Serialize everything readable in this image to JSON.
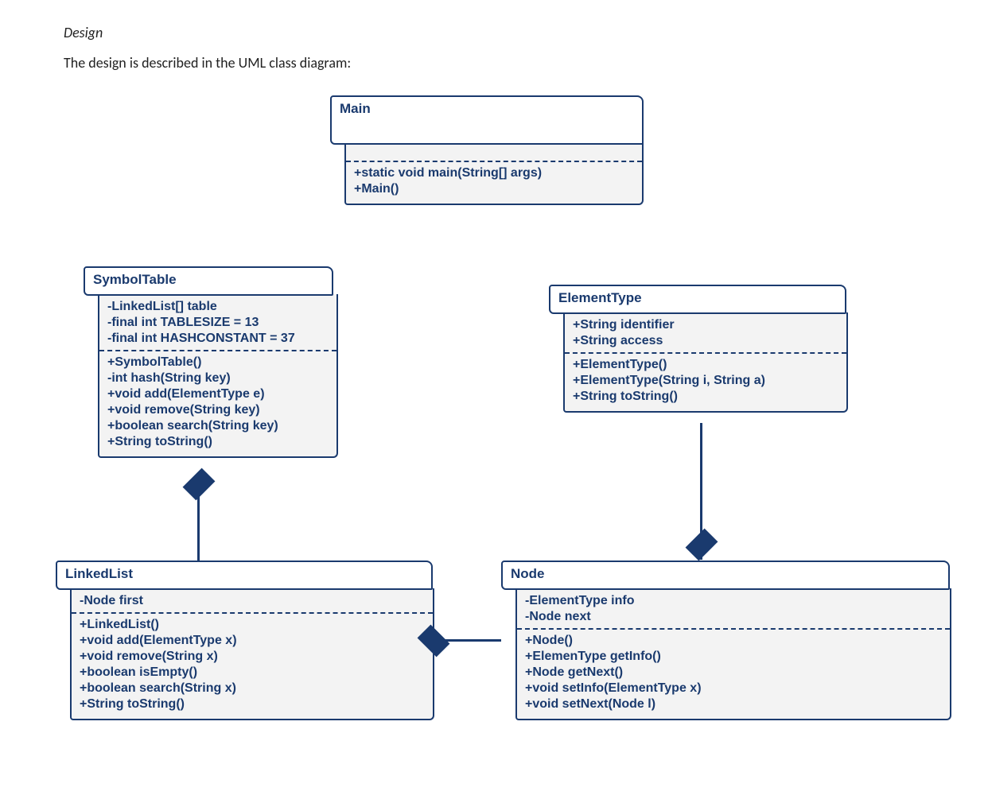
{
  "heading": {
    "title": "Design",
    "description": "The design is described in the UML class diagram:"
  },
  "classes": {
    "Main": {
      "name": "Main",
      "attributes": [],
      "methods": [
        "+static void main(String[] args)",
        "+Main()"
      ]
    },
    "SymbolTable": {
      "name": "SymbolTable",
      "attributes": [
        "-LinkedList[] table",
        "-final int TABLESIZE = 13",
        "-final int HASHCONSTANT = 37"
      ],
      "methods": [
        "+SymbolTable()",
        "-int hash(String key)",
        "+void add(ElementType e)",
        "+void remove(String key)",
        "+boolean search(String key)",
        "+String toString()"
      ]
    },
    "ElementType": {
      "name": "ElementType",
      "attributes": [
        "+String identifier",
        "+String access"
      ],
      "methods": [
        "+ElementType()",
        "+ElementType(String i, String a)",
        "+String toString()"
      ]
    },
    "LinkedList": {
      "name": "LinkedList",
      "attributes": [
        "-Node first"
      ],
      "methods": [
        "+LinkedList()",
        "+void add(ElementType x)",
        "+void remove(String x)",
        "+boolean isEmpty()",
        "+boolean search(String x)",
        "+String toString()"
      ]
    },
    "Node": {
      "name": "Node",
      "attributes": [
        "-ElementType info",
        "-Node next"
      ],
      "methods": [
        "+Node()",
        "+ElemenType getInfo()",
        "+Node getNext()",
        "+void setInfo(ElementType x)",
        "+void setNext(Node l)"
      ]
    }
  },
  "relationships": [
    {
      "type": "composition",
      "whole": "SymbolTable",
      "part": "LinkedList"
    },
    {
      "type": "composition",
      "whole": "LinkedList",
      "part": "Node"
    },
    {
      "type": "composition",
      "whole": "Node",
      "part": "ElementType"
    }
  ]
}
